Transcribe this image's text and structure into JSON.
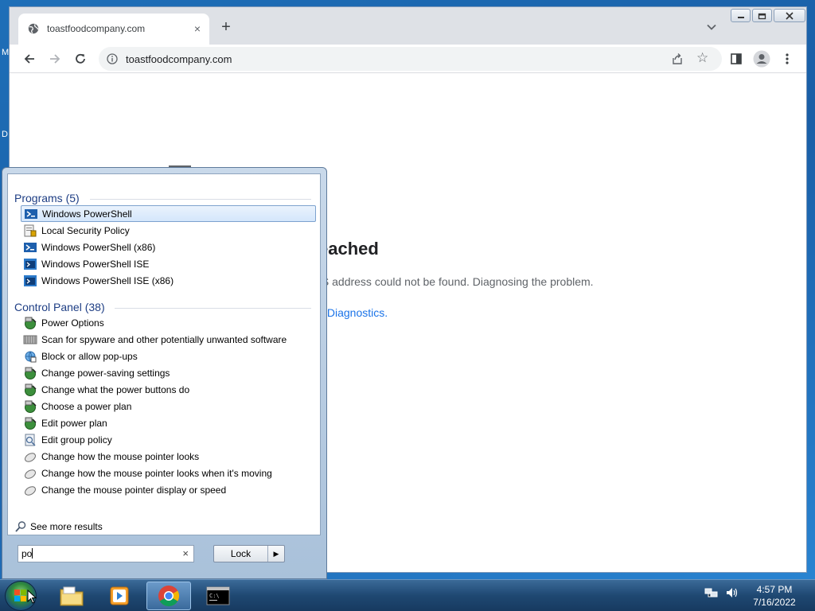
{
  "desktop": {
    "letters": [
      "M",
      "D"
    ]
  },
  "browser": {
    "tab": {
      "title": "toastfoodcompany.com",
      "close": "×"
    },
    "newtab": "+",
    "omnibox": {
      "url": "toastfoodcompany.com"
    },
    "page": {
      "error_title": "eached",
      "error_desc": "IS address could not be found. Diagnosing the problem.",
      "error_link": "k Diagnostics."
    }
  },
  "start_menu": {
    "programs": {
      "header": "Programs (5)",
      "items": [
        {
          "label": "Windows PowerShell",
          "icon": "powershell-icon",
          "selected": true
        },
        {
          "label": "Local Security Policy",
          "icon": "security-policy-icon"
        },
        {
          "label": "Windows PowerShell (x86)",
          "icon": "powershell-icon"
        },
        {
          "label": "Windows PowerShell ISE",
          "icon": "powershell-ise-icon"
        },
        {
          "label": "Windows PowerShell ISE (x86)",
          "icon": "powershell-ise-icon"
        }
      ]
    },
    "control_panel": {
      "header": "Control Panel (38)",
      "items": [
        {
          "label": "Power Options",
          "icon": "power-options-icon"
        },
        {
          "label": "Scan for spyware and other potentially unwanted software",
          "icon": "defender-icon"
        },
        {
          "label": "Block or allow pop-ups",
          "icon": "internet-options-icon"
        },
        {
          "label": "Change power-saving settings",
          "icon": "power-options-icon"
        },
        {
          "label": "Change what the power buttons do",
          "icon": "power-options-icon"
        },
        {
          "label": "Choose a power plan",
          "icon": "power-options-icon"
        },
        {
          "label": "Edit power plan",
          "icon": "power-options-icon"
        },
        {
          "label": "Edit group policy",
          "icon": "group-policy-icon"
        },
        {
          "label": "Change how the mouse pointer looks",
          "icon": "mouse-icon"
        },
        {
          "label": "Change how the mouse pointer looks when it's moving",
          "icon": "mouse-icon"
        },
        {
          "label": "Change the mouse pointer display or speed",
          "icon": "mouse-icon"
        }
      ]
    },
    "see_more": "See more results",
    "search": {
      "value": "po",
      "clear": "×"
    },
    "lock_button": {
      "label": "Lock",
      "arrow": "▶"
    }
  },
  "taskbar": {
    "clock": {
      "time": "4:57 PM",
      "date": "7/16/2022"
    }
  }
}
